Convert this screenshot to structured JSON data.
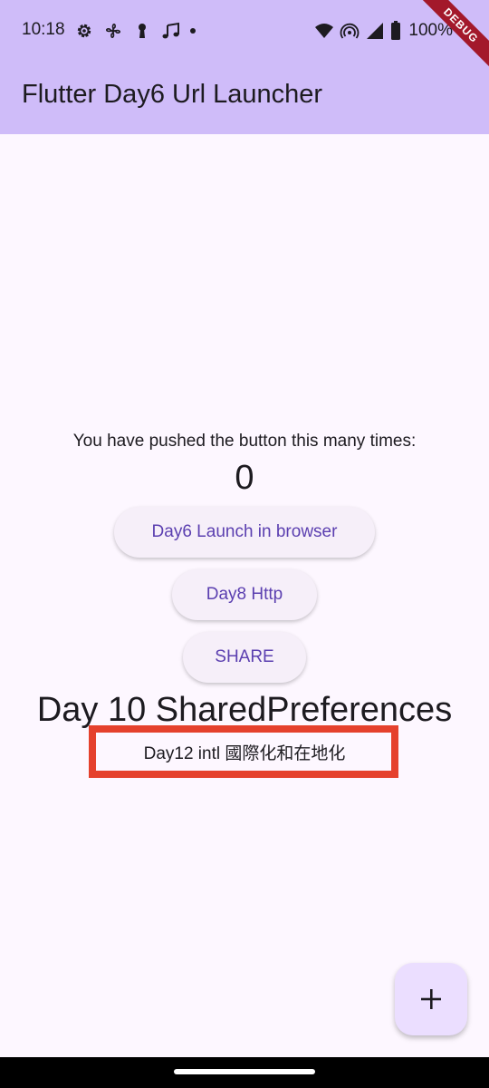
{
  "status_bar": {
    "time": "10:18",
    "battery": "100%",
    "left_icons": [
      "settings-gear-icon",
      "fan-icon",
      "keyhole-icon",
      "music-note-icon",
      "notification-dot-icon"
    ],
    "right_icons": [
      "wifi-icon",
      "hotspot-icon",
      "cell-signal-icon",
      "battery-icon"
    ]
  },
  "app_bar": {
    "title": "Flutter Day6 Url Launcher"
  },
  "debug_banner": "DEBUG",
  "body": {
    "counter_label": "You have pushed the button this many times:",
    "counter_value": "0",
    "buttons": {
      "launch_browser": "Day6 Launch in browser",
      "http": "Day8 Http",
      "share": "SHARE"
    },
    "day10_text": "Day 10 SharedPreferences",
    "day12_text": "Day12 intl 國際化和在地化"
  },
  "fab": {
    "icon": "plus-icon"
  },
  "colors": {
    "app_bar": "#cfbcf9",
    "background": "#fdf7ff",
    "button_text": "#5b3fb0",
    "highlight_box": "#e5412d",
    "fab": "#ebdeff",
    "debug_ribbon": "#a3192b"
  }
}
